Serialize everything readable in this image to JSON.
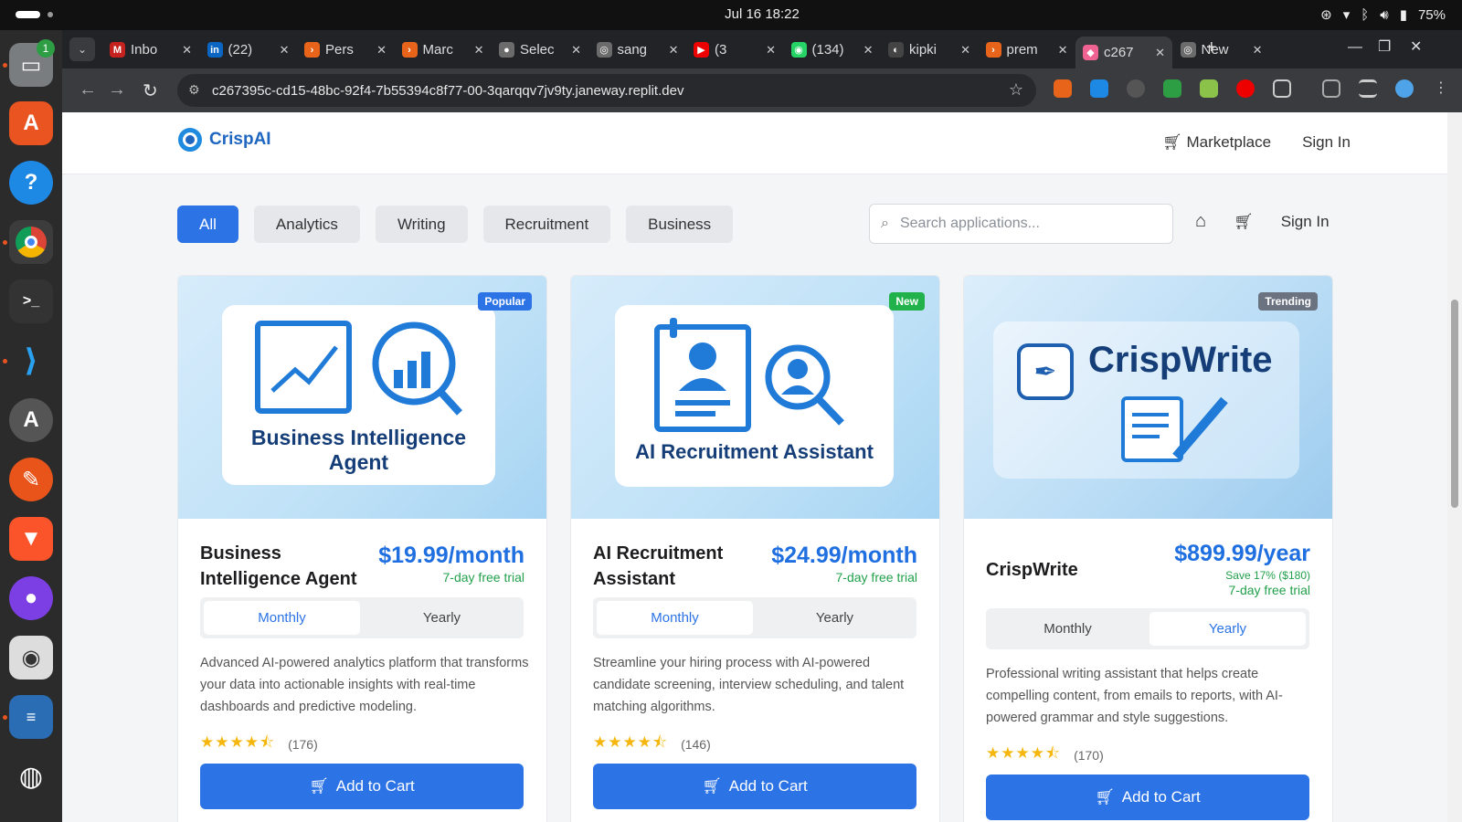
{
  "os": {
    "clock": "Jul 16  18:22",
    "battery": "75%",
    "dock_badge": "1"
  },
  "browser": {
    "tabs": [
      {
        "label": "Inbo",
        "color": "#c5221f",
        "glyph": "M"
      },
      {
        "label": "(22)",
        "color": "#0a66c2",
        "glyph": "in"
      },
      {
        "label": "Pers",
        "color": "#e8641b",
        "glyph": "›"
      },
      {
        "label": "Marc",
        "color": "#e8641b",
        "glyph": "›"
      },
      {
        "label": "Selec",
        "color": "#6b6b6b",
        "glyph": "●"
      },
      {
        "label": "sang",
        "color": "#6b6b6b",
        "glyph": "◎"
      },
      {
        "label": "(3",
        "color": "#e00",
        "glyph": "▶"
      },
      {
        "label": "(134)",
        "color": "#25d366",
        "glyph": "◉"
      },
      {
        "label": "kipki",
        "color": "#444",
        "glyph": "◐"
      },
      {
        "label": "prem",
        "color": "#e8641b",
        "glyph": "›"
      },
      {
        "label": "c267",
        "color": "#f06292",
        "glyph": "◆"
      },
      {
        "label": "New",
        "color": "#6b6b6b",
        "glyph": "◎"
      }
    ],
    "url": "c267395c-cd15-48bc-92f4-7b55394c8f77-00-3qarqqv7jv9ty.janeway.replit.dev"
  },
  "site": {
    "logo": "CrispAI",
    "nav_marketplace": "Marketplace",
    "nav_signin": "Sign In",
    "filters": [
      "All",
      "Analytics",
      "Writing",
      "Recruitment",
      "Business"
    ],
    "search_placeholder": "Search applications...",
    "signin2": "Sign In"
  },
  "products": [
    {
      "badge": "Popular",
      "badge_color": "#2c73e6",
      "banner_text": "Business Intelligence Agent",
      "title_l1": "Business",
      "title_l2": "Intelligence Agent",
      "price": "$19.99/month",
      "save": "",
      "trial": "7-day free trial",
      "monthly": "Monthly",
      "yearly": "Yearly",
      "selected_plan": "Monthly",
      "description": "Advanced AI-powered analytics platform that transforms your data into actionable insights with real-time dashboards and predictive modeling.",
      "rating": 4.5,
      "reviews": "(176)",
      "cta": "Add to Cart"
    },
    {
      "badge": "New",
      "badge_color": "#22b24c",
      "banner_text": "AI Recruitment Assistant",
      "title_l1": "AI Recruitment",
      "title_l2": "Assistant",
      "price": "$24.99/month",
      "save": "",
      "trial": "7-day free trial",
      "monthly": "Monthly",
      "yearly": "Yearly",
      "selected_plan": "Monthly",
      "description": "Streamline your hiring process with AI-powered candidate screening, interview scheduling, and talent matching algorithms.",
      "rating": 4.5,
      "reviews": "(146)",
      "cta": "Add to Cart"
    },
    {
      "badge": "Trending",
      "badge_color": "#6b7280",
      "banner_text": "CrispWrite",
      "title_l1": "CrispWrite",
      "title_l2": "",
      "price": "$899.99/year",
      "save": "Save 17% ($180)",
      "trial": "7-day free trial",
      "monthly": "Monthly",
      "yearly": "Yearly",
      "selected_plan": "Yearly",
      "description": "Professional writing assistant that helps create compelling content, from emails to reports, with AI-powered grammar and style suggestions.",
      "rating": 4.5,
      "reviews": "(170)",
      "cta": "Add to Cart"
    }
  ]
}
